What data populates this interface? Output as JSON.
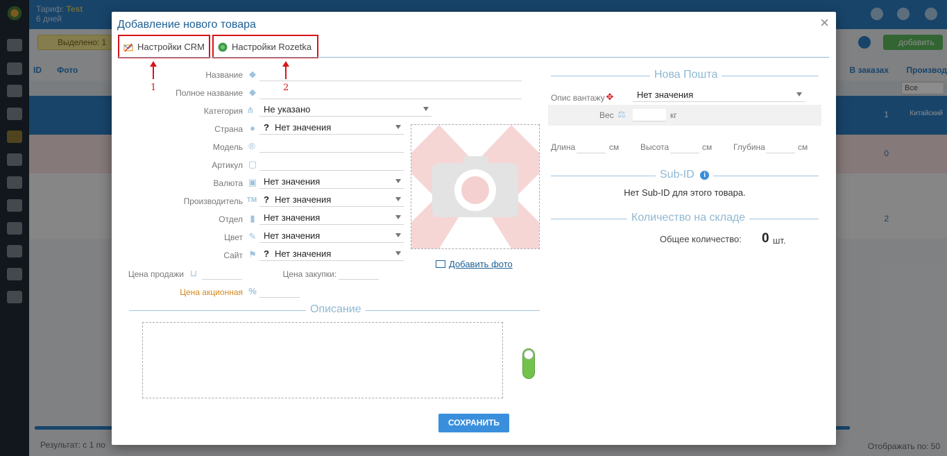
{
  "background": {
    "tariff_label": "Тариф:",
    "tariff_name": "Test",
    "tariff_days": "6 дней",
    "notice_label": "Выделено: 1",
    "add_button": "добавить",
    "col_id": "ID",
    "col_photo": "Фото",
    "col_in_orders": "В заказах",
    "col_manufacturer": "Производ",
    "filter_all": "Все",
    "row_brand": "Китайский",
    "row_qty_1": "1",
    "row_qty_2": "0",
    "row_qty_3": "2",
    "footer_result": "Результат: с 1 по",
    "footer_per_page": "Отображать по: 50"
  },
  "modal": {
    "title": "Добавление нового товара",
    "close": "×",
    "tabs": [
      {
        "label": "Настройки CRM"
      },
      {
        "label": "Настройки Rozetka"
      }
    ],
    "annotations": [
      "1",
      "2"
    ]
  },
  "form": {
    "name_label": "Название",
    "fullname_label": "Полное название",
    "category_label": "Категория",
    "category_value": "Не указано",
    "country_label": "Страна",
    "country_value": "Нет значения",
    "model_label": "Модель",
    "article_label": "Артикул",
    "currency_label": "Валюта",
    "currency_value": "Нет значения",
    "manufacturer_label": "Производитель",
    "manufacturer_value": "Нет значения",
    "department_label": "Отдел",
    "department_value": "Нет значения",
    "color_label": "Цвет",
    "color_value": "Нет значения",
    "site_label": "Сайт",
    "site_value": "Нет значения",
    "question_mark": "?",
    "sale_price_label": "Цена продажи",
    "purchase_price_label": "Цена закупки:",
    "promo_price_label": "Цена акционная",
    "add_photo": "Добавить фото",
    "description_title": "Описание",
    "save_button": "СОХРАНИТЬ"
  },
  "right": {
    "np_title": "Нова Пошта",
    "cargo_desc_label": "Опис вантажу",
    "cargo_desc_value": "Нет значения",
    "weight_label": "Вес",
    "weight_unit": "кг",
    "length_label": "Длина",
    "height_label": "Высота",
    "depth_label": "Глубина",
    "dim_unit": "см",
    "subid_title": "Sub-ID",
    "subid_empty": "Нет Sub-ID для этого товара.",
    "stock_title": "Количество на складе",
    "stock_total_label": "Общее количество:",
    "stock_total_value": "0",
    "stock_unit": "шт."
  },
  "colors": {
    "accent": "#1c5f94",
    "highlight": "#d8141a",
    "save": "#3a8fdd",
    "toggle_on": "#72c34b"
  }
}
